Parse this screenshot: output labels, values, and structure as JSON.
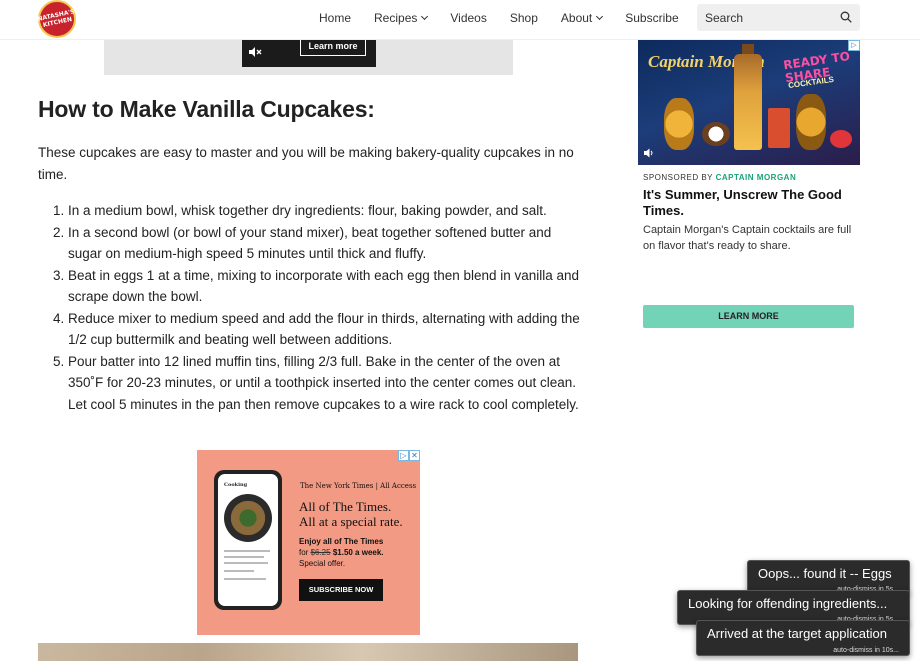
{
  "header": {
    "logo_text": "NATASHA'S KITCHEN",
    "nav": [
      {
        "label": "Home",
        "has_dropdown": false
      },
      {
        "label": "Recipes",
        "has_dropdown": true
      },
      {
        "label": "Videos",
        "has_dropdown": false
      },
      {
        "label": "Shop",
        "has_dropdown": false
      },
      {
        "label": "About",
        "has_dropdown": true
      },
      {
        "label": "Subscribe",
        "has_dropdown": false
      }
    ],
    "search": {
      "placeholder": "Search",
      "icon": "search-icon"
    }
  },
  "video_ad": {
    "button_label": "Learn more",
    "icon": "mute-icon"
  },
  "article": {
    "heading": "How to Make Vanilla Cupcakes:",
    "intro": "These cupcakes are easy to master and you will be making bakery-quality cupcakes in no time.",
    "steps": [
      "In a medium bowl, whisk together dry ingredients: flour, baking powder, and salt.",
      "In a second bowl (or bowl of your stand mixer), beat together softened butter and sugar on medium-high speed 5 minutes until thick and fluffy.",
      "Beat in eggs 1 at a time, mixing to incorporate with each egg then blend in vanilla and scrape down the bowl.",
      "Reduce mixer to medium speed and add the flour in thirds, alternating with adding the 1/2 cup buttermilk and beating well between additions.",
      "Pour batter into 12 lined muffin tins, filling 2/3 full. Bake in the center of the oven at 350˚F for 20-23 minutes, or until a toothpick inserted into the center comes out clean. Let cool 5 minutes in the pan then remove cupcakes to a wire rack to cool completely."
    ]
  },
  "nyt_ad": {
    "masthead": "The New York Times | All Access",
    "headline_1": "All of The Times.",
    "headline_2": "All at a special rate.",
    "offer_line_1": "Enjoy all of The Times",
    "offer_prefix": "for ",
    "old_price": "$6.25",
    "new_price": " $1.50 a week.",
    "offer_line_3": "Special offer.",
    "button_label": "SUBSCRIBE NOW",
    "phone_app": "Cooking",
    "background_color": "#f29a84"
  },
  "sidebar_ad": {
    "image_brand": "Captain Morgan",
    "image_tagline": "READY TO SHARE",
    "image_subtagline": "COCKTAILS",
    "sponsored_prefix": "SPONSORED BY ",
    "sponsor": "CAPTAIN MORGAN",
    "title": "It's Summer, Unscrew The Good Times.",
    "description": "Captain Morgan's Captain cocktails are full on flavor that's ready to share.",
    "button_label": "LEARN MORE",
    "button_color": "#73d3b6",
    "sponsor_color": "#1aa37a"
  },
  "toasts": [
    {
      "message": "Oops... found it -- Eggs",
      "dismiss": "auto-dismiss in 5s..."
    },
    {
      "message": "Looking for offending ingredients...",
      "dismiss": "auto-dismiss in 5s..."
    },
    {
      "message": "Arrived at the target application",
      "dismiss": "auto-dismiss in 10s..."
    }
  ]
}
